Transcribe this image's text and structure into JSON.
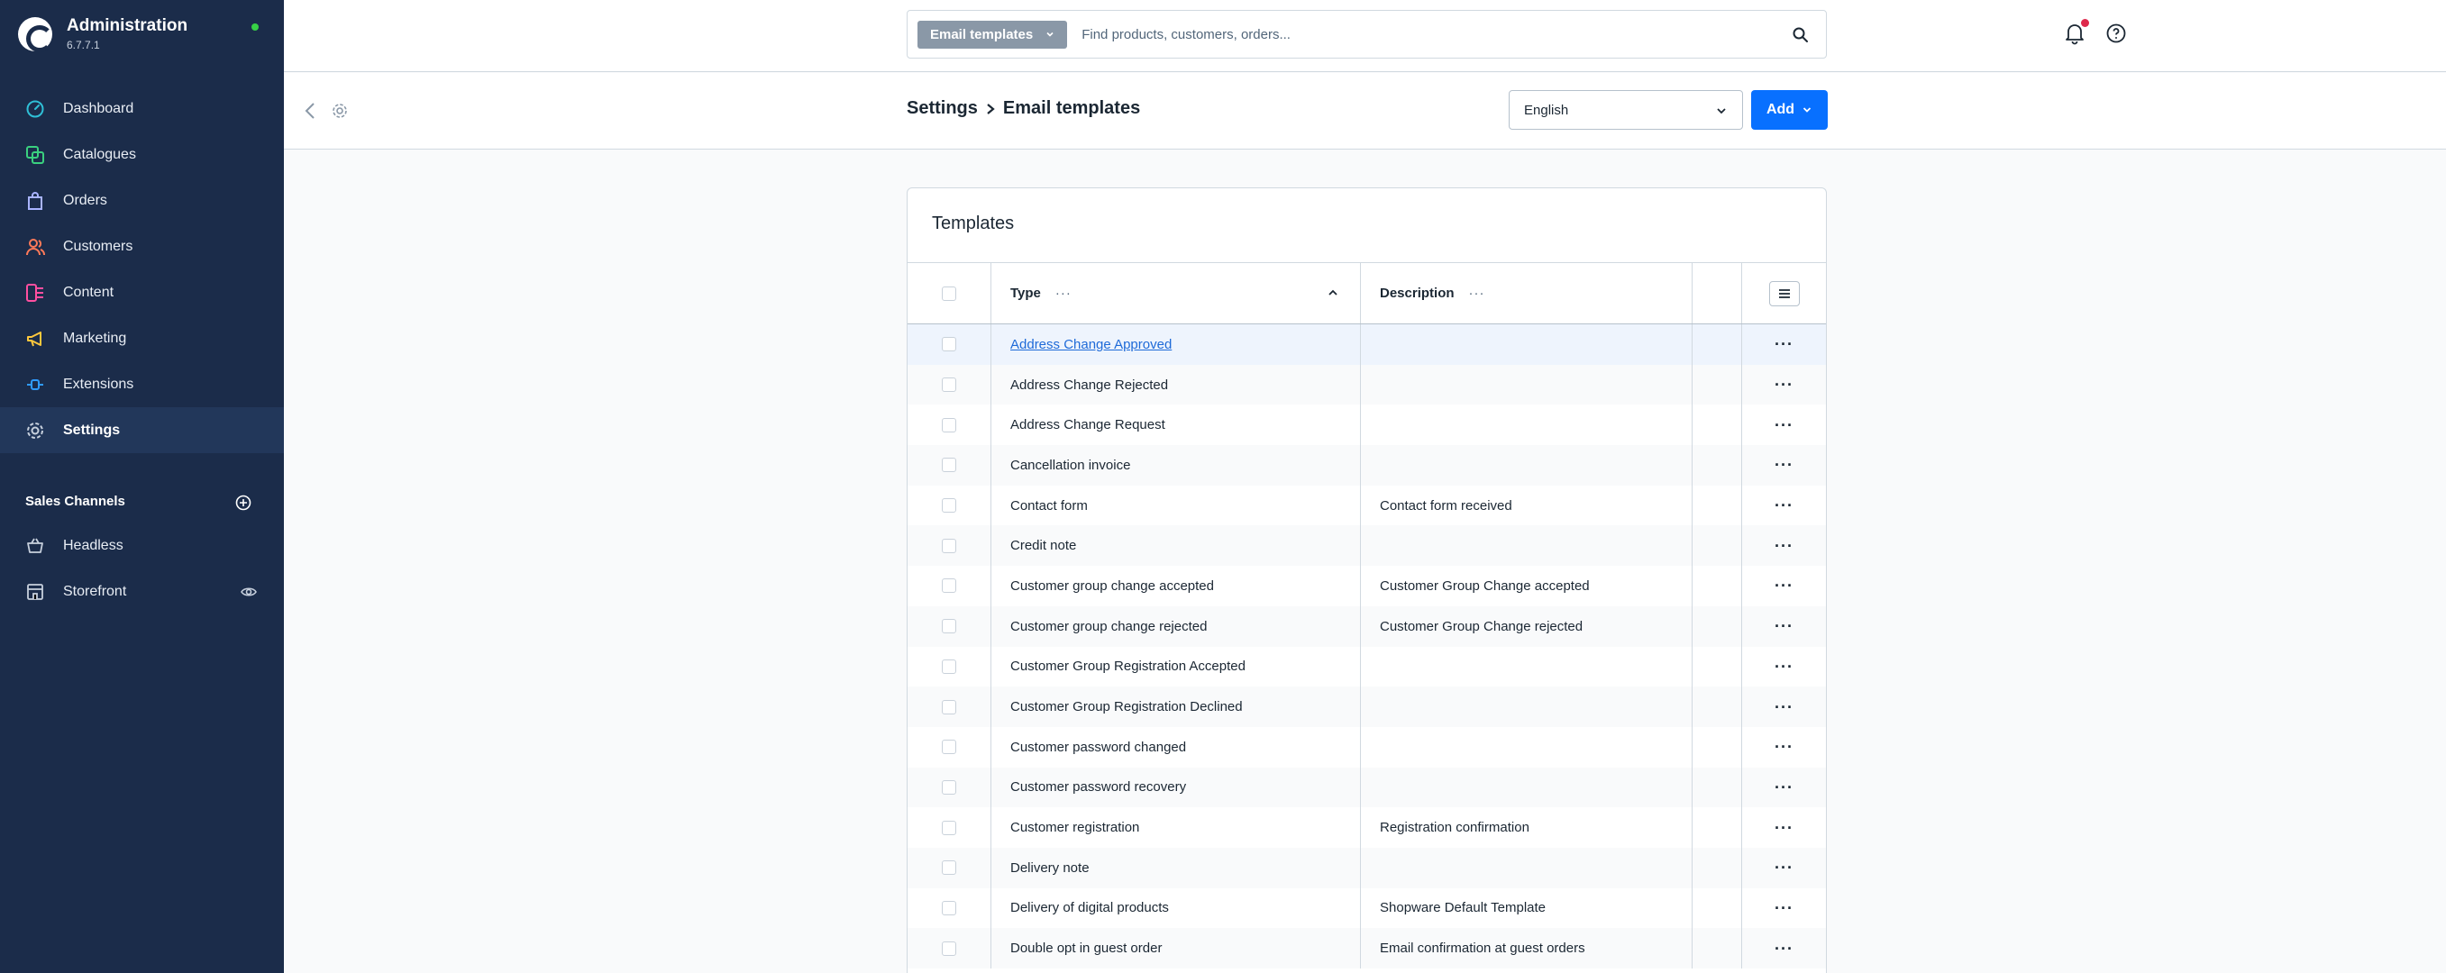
{
  "app": {
    "title": "Administration",
    "version": "6.7.7.1"
  },
  "sidebar": {
    "items": [
      {
        "label": "Dashboard",
        "icon": "dashboard-icon",
        "color": "#2fbfd6"
      },
      {
        "label": "Catalogues",
        "icon": "catalogues-icon",
        "color": "#3ad07f"
      },
      {
        "label": "Orders",
        "icon": "orders-icon",
        "color": "#a9b4ff"
      },
      {
        "label": "Customers",
        "icon": "customers-icon",
        "color": "#ff7a59"
      },
      {
        "label": "Content",
        "icon": "content-icon",
        "color": "#ff4fa0"
      },
      {
        "label": "Marketing",
        "icon": "marketing-icon",
        "color": "#ffc83d"
      },
      {
        "label": "Extensions",
        "icon": "extensions-icon",
        "color": "#2f9bff"
      },
      {
        "label": "Settings",
        "icon": "settings-icon",
        "color": "#c7d0dd"
      }
    ],
    "sales_channels_title": "Sales Channels",
    "sales_channels": [
      {
        "label": "Headless",
        "icon": "basket-icon"
      },
      {
        "label": "Storefront",
        "icon": "storefront-icon"
      }
    ]
  },
  "topbar": {
    "search_tag": "Email templates",
    "search_placeholder": "Find products, customers, orders..."
  },
  "smartbar": {
    "breadcrumb_parent": "Settings",
    "breadcrumb_current": "Email templates",
    "language": "English",
    "add_label": "Add"
  },
  "card": {
    "title": "Templates",
    "columns": {
      "type": "Type",
      "description": "Description",
      "dots": "···"
    },
    "rows": [
      {
        "type": "Address Change Approved",
        "description": ""
      },
      {
        "type": "Address Change Rejected",
        "description": ""
      },
      {
        "type": "Address Change Request",
        "description": ""
      },
      {
        "type": "Cancellation invoice",
        "description": ""
      },
      {
        "type": "Contact form",
        "description": "Contact form received"
      },
      {
        "type": "Credit note",
        "description": ""
      },
      {
        "type": "Customer group change accepted",
        "description": "Customer Group Change accepted"
      },
      {
        "type": "Customer group change rejected",
        "description": "Customer Group Change rejected"
      },
      {
        "type": "Customer Group Registration Accepted",
        "description": ""
      },
      {
        "type": "Customer Group Registration Declined",
        "description": ""
      },
      {
        "type": "Customer password changed",
        "description": ""
      },
      {
        "type": "Customer password recovery",
        "description": ""
      },
      {
        "type": "Customer registration",
        "description": "Registration confirmation"
      },
      {
        "type": "Delivery note",
        "description": ""
      },
      {
        "type": "Delivery of digital products",
        "description": "Shopware Default Template"
      },
      {
        "type": "Double opt in guest order",
        "description": "Email confirmation at guest orders"
      }
    ],
    "row_action": "···"
  }
}
